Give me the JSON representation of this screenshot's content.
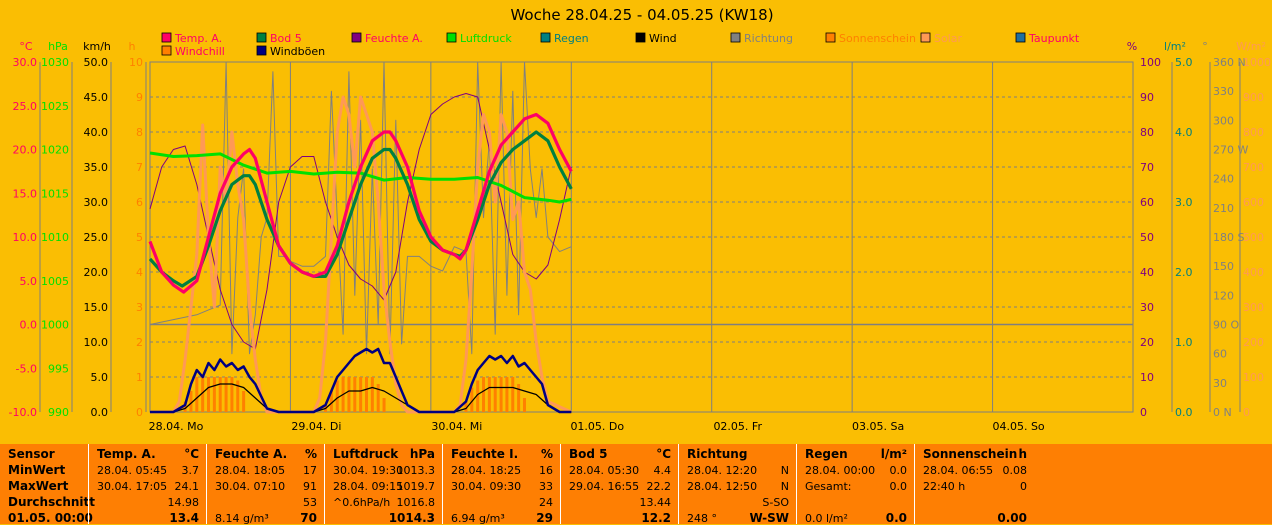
{
  "title": "Woche 28.04.25 - 04.05.25 (KW18)",
  "colors": {
    "background": "#FABE03",
    "plot_bg": "#FABE03",
    "table_bg": "#FE7F03",
    "temp": "#FF0066",
    "bod5": "#008040",
    "feuchte": "#800080",
    "luftdruck": "#00E000",
    "regen": "#008080",
    "wind": "#000000",
    "windboeen": "#000080",
    "richtung": "#808080",
    "sonnenschein": "#FF8000",
    "solar": "#FF9955",
    "taupunkt": "#1F6F9F",
    "windchill": "#FF8000"
  },
  "legend": [
    {
      "label": "Temp. A.",
      "color": "#FF0066",
      "text_color": "#FF0066"
    },
    {
      "label": "Bod 5",
      "color": "#008040",
      "text_color": "#FF0066"
    },
    {
      "label": "Feuchte A.",
      "color": "#800080",
      "text_color": "#FF0066"
    },
    {
      "label": "Luftdruck",
      "color": "#00E000",
      "text_color": "#00E000"
    },
    {
      "label": "Regen",
      "color": "#008080",
      "text_color": "#008080"
    },
    {
      "label": "Wind",
      "color": "#000000",
      "text_color": "#000000"
    },
    {
      "label": "Richtung",
      "color": "#808080",
      "text_color": "#808080"
    },
    {
      "label": "Sonnenschein",
      "color": "#FF8000",
      "text_color": "#FF8000"
    },
    {
      "label": "Solar",
      "color": "#FF9955",
      "text_color": "#FF9955"
    },
    {
      "label": "Taupunkt",
      "color": "#1F6F9F",
      "text_color": "#FF0066"
    },
    {
      "label": "Windchill",
      "color": "#FF8000",
      "text_color": "#FF0066"
    },
    {
      "label": "Windböen",
      "color": "#000080",
      "text_color": "#000000"
    }
  ],
  "axes": {
    "left": [
      {
        "unit": "°C",
        "color": "#FF0066",
        "ticks": [
          "30.0",
          "25.0",
          "20.0",
          "15.0",
          "10.0",
          "5.0",
          "0.0",
          "-5.0",
          "-10.0"
        ]
      },
      {
        "unit": "hPa",
        "color": "#00E000",
        "ticks": [
          "1030",
          "1025",
          "1020",
          "1015",
          "1010",
          "1005",
          "1000",
          "995",
          "990"
        ]
      },
      {
        "unit": "km/h",
        "color": "#000000",
        "ticks": [
          "50.0",
          "45.0",
          "40.0",
          "35.0",
          "30.0",
          "25.0",
          "20.0",
          "15.0",
          "10.0",
          "5.0",
          "0.0"
        ]
      },
      {
        "unit": "h",
        "color": "#FF8000",
        "ticks": [
          "10",
          "9",
          "8",
          "7",
          "6",
          "5",
          "4",
          "3",
          "2",
          "1",
          "0"
        ]
      }
    ],
    "right": [
      {
        "unit": "%",
        "color": "#800080",
        "ticks": [
          "100",
          "90",
          "80",
          "70",
          "60",
          "50",
          "40",
          "30",
          "20",
          "10",
          "0"
        ]
      },
      {
        "unit": "l/m²",
        "color": "#008080",
        "ticks": [
          "5.0",
          "4.0",
          "3.0",
          "2.0",
          "1.0",
          "0.0"
        ]
      },
      {
        "unit": "°",
        "color": "#808080",
        "ticks": [
          "360 N",
          "330",
          "300",
          "270 W",
          "240",
          "210",
          "180 S",
          "150",
          "120",
          "90 O",
          "60",
          "30",
          "0 N"
        ]
      },
      {
        "unit": "W/m²",
        "color": "#FF9955",
        "ticks": [
          "1000",
          "900",
          "800",
          "700",
          "600",
          "500",
          "400",
          "300",
          "200",
          "100",
          "0"
        ]
      }
    ],
    "x_ticks": [
      "28.04. Mo",
      "29.04. Di",
      "30.04. Mi",
      "01.05. Do",
      "02.05. Fr",
      "03.05. Sa",
      "04.05. So"
    ]
  },
  "chart_data": {
    "type": "line",
    "title": "Woche 28.04.25 - 04.05.25 (KW18)",
    "x_unit": "hours since 28.04. 00:00",
    "x_range": [
      0,
      168
    ],
    "grid": true,
    "series": [
      {
        "name": "Temp. A.",
        "axis": "°C",
        "ylim": [
          -10,
          30
        ],
        "x": [
          0,
          2,
          4,
          5.75,
          8,
          10,
          12,
          14,
          16,
          17,
          18,
          20,
          22,
          24,
          26,
          28,
          30,
          32,
          34,
          36,
          38,
          40,
          41,
          42,
          44,
          46,
          48,
          50,
          52,
          53,
          54,
          56,
          58,
          60,
          62,
          64,
          66,
          68,
          70,
          72
        ],
        "values": [
          9.5,
          6,
          4.5,
          3.7,
          5,
          10,
          15,
          18,
          19.5,
          20,
          19,
          14,
          9,
          7,
          6,
          5.5,
          6,
          9,
          14,
          18,
          21,
          22,
          22,
          21,
          18,
          13,
          10,
          8.5,
          8,
          7.5,
          8.5,
          13,
          17.5,
          20.5,
          22,
          23.5,
          24,
          23,
          20,
          17.5
        ]
      },
      {
        "name": "Bod 5",
        "axis": "°C",
        "ylim": [
          -10,
          30
        ],
        "x": [
          0,
          2,
          4,
          5.5,
          8,
          10,
          12,
          14,
          16,
          17,
          18,
          20,
          22,
          24,
          26,
          28,
          30,
          32,
          34,
          36,
          38,
          40,
          41,
          42,
          44,
          46,
          48,
          50,
          52,
          53,
          54,
          56,
          58,
          60,
          62,
          64,
          66,
          68,
          70,
          72
        ],
        "values": [
          7.5,
          6,
          5,
          4.4,
          5.5,
          9,
          13,
          16,
          17,
          17,
          16,
          12,
          9,
          7,
          6,
          5.5,
          5.5,
          8,
          12,
          16,
          19,
          20,
          20,
          19,
          16,
          12,
          9.5,
          8.5,
          8,
          7.8,
          8.5,
          12,
          16,
          18.5,
          20,
          21,
          22,
          21,
          18,
          15.5
        ]
      },
      {
        "name": "Feuchte A.",
        "axis": "%",
        "ylim": [
          0,
          100
        ],
        "x": [
          0,
          2,
          4,
          6,
          8,
          10,
          12,
          14,
          16,
          18,
          20,
          22,
          24,
          26,
          28,
          30,
          31,
          32,
          34,
          36,
          38,
          40,
          42,
          44,
          46,
          48,
          50,
          52,
          54,
          56,
          58,
          60,
          62,
          64,
          66,
          68,
          70,
          72
        ],
        "values": [
          58,
          70,
          75,
          76,
          65,
          50,
          35,
          25,
          20,
          18,
          35,
          60,
          70,
          73,
          73,
          60,
          55,
          50,
          42,
          38,
          36,
          32,
          40,
          60,
          75,
          85,
          88,
          90,
          91,
          90,
          75,
          60,
          45,
          40,
          38,
          42,
          55,
          70
        ]
      },
      {
        "name": "Luftdruck",
        "axis": "hPa",
        "ylim": [
          990,
          1030
        ],
        "x": [
          0,
          4,
          8,
          12,
          16,
          20,
          24,
          28,
          32,
          36,
          40,
          44,
          48,
          52,
          56,
          60,
          64,
          68,
          70,
          72
        ],
        "values": [
          1019.6,
          1019.2,
          1019.3,
          1019.5,
          1018.2,
          1017.3,
          1017.5,
          1017.2,
          1017.4,
          1017.3,
          1016.5,
          1016.8,
          1016.6,
          1016.6,
          1016.8,
          1015.9,
          1014.5,
          1014.2,
          1014.0,
          1014.3
        ]
      },
      {
        "name": "Wind",
        "axis": "km/h",
        "ylim": [
          0,
          50
        ],
        "x": [
          0,
          4,
          6,
          8,
          10,
          12,
          14,
          16,
          18,
          20,
          22,
          24,
          28,
          30,
          32,
          34,
          36,
          38,
          40,
          42,
          44,
          46,
          48,
          52,
          54,
          56,
          58,
          60,
          62,
          64,
          66,
          68,
          70,
          72
        ],
        "values": [
          0,
          0,
          0.5,
          2,
          3.5,
          4,
          4,
          3.5,
          2,
          0.5,
          0,
          0,
          0,
          0.5,
          2,
          3,
          3,
          3.5,
          3,
          2,
          1,
          0,
          0,
          0,
          0.5,
          2.5,
          3.5,
          3.5,
          3.5,
          3,
          2.5,
          1,
          0,
          0
        ]
      },
      {
        "name": "Windböen",
        "axis": "km/h",
        "ylim": [
          0,
          50
        ],
        "x": [
          0,
          4,
          6,
          7,
          8,
          9,
          10,
          11,
          12,
          13,
          14,
          15,
          16,
          17,
          18,
          20,
          22,
          24,
          28,
          30,
          31,
          32,
          33,
          34,
          35,
          36,
          37,
          38,
          39,
          40,
          41,
          42,
          43,
          44,
          46,
          48,
          52,
          54,
          55,
          56,
          57,
          58,
          59,
          60,
          61,
          62,
          63,
          64,
          65,
          66,
          67,
          68,
          70,
          72
        ],
        "values": [
          0,
          0,
          1,
          4,
          6,
          5,
          7,
          6,
          7.5,
          6.5,
          7,
          6,
          6.5,
          5,
          4,
          0.5,
          0,
          0,
          0,
          1,
          3,
          5,
          6,
          7,
          8,
          8.5,
          9,
          8.5,
          9,
          7,
          7,
          5,
          3,
          1,
          0,
          0,
          0,
          1.5,
          4,
          6,
          7,
          8,
          7.5,
          8,
          7,
          8,
          6.5,
          7,
          6,
          5,
          4,
          1,
          0,
          0
        ]
      },
      {
        "name": "Richtung",
        "axis": "°",
        "ylim": [
          0,
          360
        ],
        "x": [
          0,
          4,
          8,
          10,
          12,
          13,
          14,
          15,
          16,
          17,
          18,
          19,
          20,
          21,
          22,
          23,
          24,
          26,
          28,
          30,
          31,
          32,
          33,
          34,
          35,
          36,
          37,
          38,
          39,
          40,
          41,
          42,
          43,
          44,
          46,
          48,
          50,
          52,
          54,
          55,
          56,
          57,
          58,
          59,
          60,
          61,
          62,
          63,
          64,
          65,
          66,
          67,
          68,
          70,
          72
        ],
        "values": [
          90,
          95,
          100,
          105,
          110,
          360,
          60,
          200,
          250,
          60,
          100,
          180,
          200,
          350,
          160,
          160,
          155,
          150,
          150,
          160,
          330,
          200,
          80,
          350,
          120,
          300,
          60,
          250,
          90,
          360,
          60,
          300,
          70,
          160,
          160,
          150,
          145,
          170,
          165,
          60,
          360,
          200,
          280,
          80,
          360,
          120,
          330,
          100,
          360,
          250,
          200,
          250,
          180,
          165,
          170
        ]
      },
      {
        "name": "Solar",
        "axis": "W/m²",
        "ylim": [
          0,
          1000
        ],
        "x": [
          0,
          4,
          5,
          6,
          7,
          8,
          9,
          10,
          11,
          12,
          13,
          14,
          15,
          16,
          17,
          18,
          19,
          20,
          24,
          28,
          29,
          30,
          31,
          32,
          33,
          34,
          35,
          36,
          37,
          38,
          39,
          40,
          41,
          42,
          43,
          44,
          48,
          52,
          53,
          54,
          55,
          56,
          57,
          58,
          59,
          60,
          61,
          62,
          63,
          64,
          65,
          66,
          67,
          68,
          72
        ],
        "values": [
          0,
          0,
          30,
          150,
          300,
          450,
          820,
          500,
          300,
          700,
          600,
          800,
          650,
          550,
          300,
          150,
          40,
          0,
          0,
          0,
          40,
          200,
          500,
          800,
          900,
          850,
          700,
          900,
          850,
          800,
          600,
          350,
          200,
          80,
          20,
          0,
          0,
          0,
          20,
          150,
          400,
          700,
          850,
          800,
          600,
          850,
          800,
          550,
          600,
          400,
          350,
          200,
          100,
          30,
          0
        ]
      },
      {
        "name": "Sonnenschein",
        "axis": "h",
        "ylim": [
          0,
          10
        ],
        "x": [
          6,
          7,
          8,
          9,
          10,
          11,
          12,
          13,
          14,
          15,
          16,
          30,
          31,
          32,
          33,
          34,
          35,
          36,
          37,
          38,
          39,
          40,
          54,
          55,
          56,
          57,
          58,
          59,
          60,
          61,
          62,
          63,
          64
        ],
        "values": [
          0.3,
          0.6,
          1.0,
          1.0,
          1.0,
          1.0,
          1.0,
          1.0,
          1.0,
          0.9,
          0.6,
          0.2,
          0.6,
          0.9,
          1.0,
          1.0,
          1.0,
          1.0,
          1.0,
          1.0,
          0.8,
          0.4,
          0.3,
          0.7,
          0.9,
          1.0,
          1.0,
          1.0,
          1.0,
          1.0,
          1.0,
          0.8,
          0.4
        ]
      }
    ]
  },
  "table": [
    {
      "header": [
        "Sensor",
        ""
      ],
      "rows": [
        [
          "MinWert",
          ""
        ],
        [
          "MaxWert",
          ""
        ],
        [
          "Durchschnitt",
          ""
        ],
        [
          "01.05. 00:00",
          ""
        ]
      ]
    },
    {
      "header": [
        "Temp. A.",
        "°C"
      ],
      "rows": [
        [
          "28.04.  05:45",
          "3.7"
        ],
        [
          "30.04.  17:05",
          "24.1"
        ],
        [
          "",
          "14.98"
        ],
        [
          "",
          "13.4"
        ]
      ]
    },
    {
      "header": [
        "Feuchte A.",
        "%"
      ],
      "rows": [
        [
          "28.04.  18:05",
          "17"
        ],
        [
          "30.04.  07:10",
          "91"
        ],
        [
          "",
          "53"
        ],
        [
          "8.14 g/m³",
          "70"
        ]
      ]
    },
    {
      "header": [
        "Luftdruck",
        "hPa"
      ],
      "rows": [
        [
          "30.04.  19:30",
          "1013.3"
        ],
        [
          "28.04.  09:15",
          "1019.7"
        ],
        [
          "^0.6hPa/h",
          "1016.8"
        ],
        [
          "",
          "1014.3"
        ]
      ]
    },
    {
      "header": [
        "Feuchte I.",
        "%"
      ],
      "rows": [
        [
          "28.04.  18:25",
          "16"
        ],
        [
          "30.04.  09:30",
          "33"
        ],
        [
          "",
          "24"
        ],
        [
          "6.94 g/m³",
          "29"
        ]
      ]
    },
    {
      "header": [
        "Bod 5",
        "°C"
      ],
      "rows": [
        [
          "28.04.  05:30",
          "4.4"
        ],
        [
          "29.04.  16:55",
          "22.2"
        ],
        [
          "",
          "13.44"
        ],
        [
          "",
          "12.2"
        ]
      ]
    },
    {
      "header": [
        "Richtung",
        ""
      ],
      "rows": [
        [
          "28.04.  12:20",
          "N"
        ],
        [
          "28.04.  12:50",
          "N"
        ],
        [
          "",
          "S-SO"
        ],
        [
          "248 °",
          "W-SW"
        ]
      ]
    },
    {
      "header": [
        "Regen",
        "l/m²"
      ],
      "rows": [
        [
          "28.04.  00:00",
          "0.0"
        ],
        [
          "Gesamt:",
          "0.0"
        ],
        [
          "",
          ""
        ],
        [
          "0.0 l/m²",
          "0.0"
        ]
      ]
    },
    {
      "header": [
        "Sonnenschein",
        "h"
      ],
      "rows": [
        [
          "28.04.  06:55",
          "0.08"
        ],
        [
          "22:40 h",
          "0"
        ],
        [
          "",
          ""
        ],
        [
          "",
          "0.00"
        ]
      ]
    }
  ]
}
